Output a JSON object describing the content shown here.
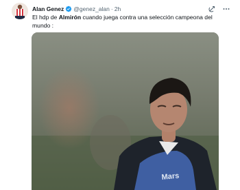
{
  "author": {
    "name": "Alan Genez",
    "handle": "@genez_alan",
    "separator": "·",
    "time": "2h"
  },
  "tweet": {
    "text_before": "El hdp de ",
    "text_bold": "Almirón",
    "text_after": " cuando juega contra una selección campeona del mundo :"
  },
  "media": {
    "shirt_text": "Mars"
  },
  "colors": {
    "verified": "#1d9bf0",
    "handle": "#536471",
    "shirt": "#3f5fa2"
  },
  "icons": {
    "verified": "verified-badge-icon",
    "grok": "grok-icon",
    "more": "more-icon"
  }
}
